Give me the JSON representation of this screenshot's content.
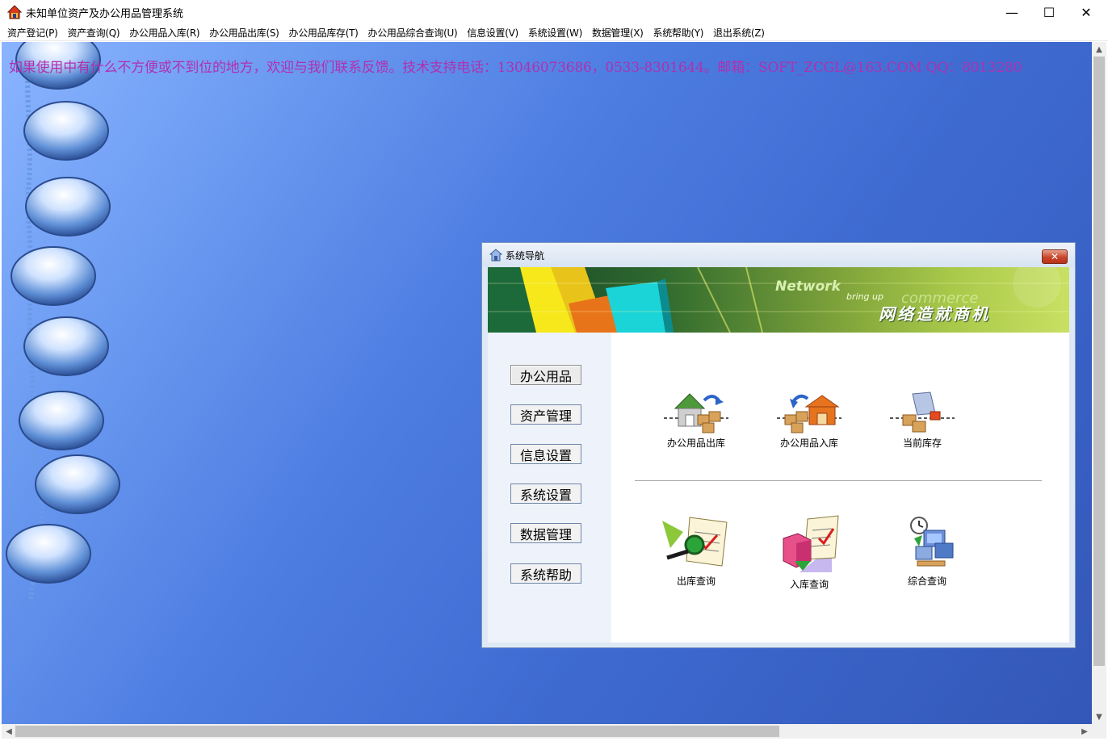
{
  "window": {
    "title": "未知单位资产及办公用品管理系统",
    "minimize_glyph": "—",
    "maximize_glyph": "☐",
    "close_glyph": "✕"
  },
  "menu": [
    "资产登记(P)",
    "资产查询(Q)",
    "办公用品入库(R)",
    "办公用品出库(S)",
    "办公用品库存(T)",
    "办公用品综合查询(U)",
    "信息设置(V)",
    "系统设置(W)",
    "数据管理(X)",
    "系统帮助(Y)",
    "退出系统(Z)"
  ],
  "notice": "如果使用中有什么不方便或不到位的地方，欢迎与我们联系反馈。技术支持电话：13046073686，0533-8301644。邮箱：SOFT_ZCGL@163.COM QQ：8013280",
  "dialog": {
    "title": "系统导航",
    "close_glyph": "✕",
    "banner": {
      "en_line1": "Network",
      "en_line2": "bring up",
      "en_line3": "commerce",
      "cn_line": "网络造就商机"
    },
    "nav_buttons": [
      "办公用品",
      "资产管理",
      "信息设置",
      "系统设置",
      "数据管理",
      "系统帮助"
    ],
    "active_nav": "办公用品",
    "functions_top": [
      "办公用品出库",
      "办公用品入库",
      "当前库存"
    ],
    "functions_bottom": [
      "出库查询",
      "入库查询",
      "综合查询"
    ]
  },
  "colors": {
    "notice_text": "#b030b0",
    "client_bg_light": "#8ab4ff",
    "client_bg_dark": "#3357b8",
    "dialog_bg": "#dfe9f5"
  },
  "icons": {
    "app": "house-app-icon",
    "dialog": "house-small-icon",
    "out": "warehouse-out-icon",
    "in": "warehouse-in-icon",
    "stock": "inventory-box-icon",
    "out_query": "magnifier-document-icon",
    "in_query": "box-document-icon",
    "combined_query": "computer-query-icon"
  }
}
